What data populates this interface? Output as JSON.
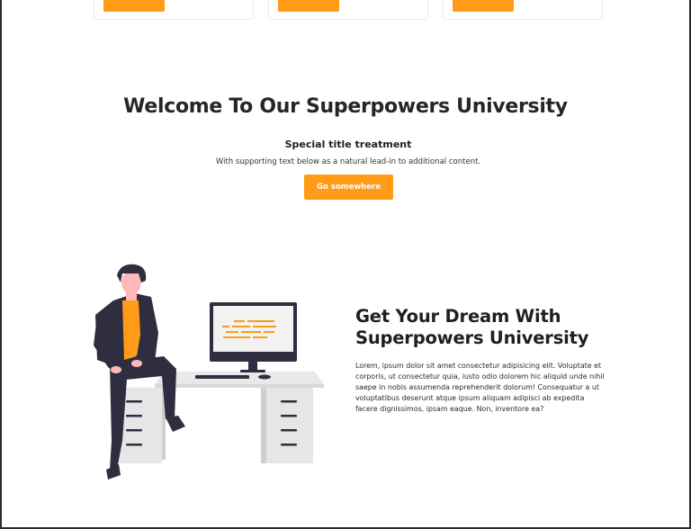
{
  "welcome": {
    "title": "Welcome To Our Superpowers University",
    "card_title": "Special title treatment",
    "card_text": "With supporting text below as a natural lead-in to additional content.",
    "button_label": "Go somewhere"
  },
  "feature": {
    "title_line1": "Get Your Dream With",
    "title_line2": "Superpowers University",
    "body": "Lorem, ipsum dolor sit amet consectetur adipisicing elit. Voluptate et corporis, ut consectetur quia, iusto odio dolorem hic aliquid unde nihil saepe in nobis assumenda reprehenderit dolorum! Consequatur a ut voluptatibus deserunt atque ipsum aliquam adipisci ab expedita facere dignissimos, ipsam eaque. Non, inventore ea?"
  },
  "colors": {
    "accent": "#ff9b17",
    "heading": "#2a2525",
    "illustration_dark": "#2f2e41"
  },
  "icons": [
    "person-at-desk-illustration",
    "computer-monitor-icon"
  ]
}
